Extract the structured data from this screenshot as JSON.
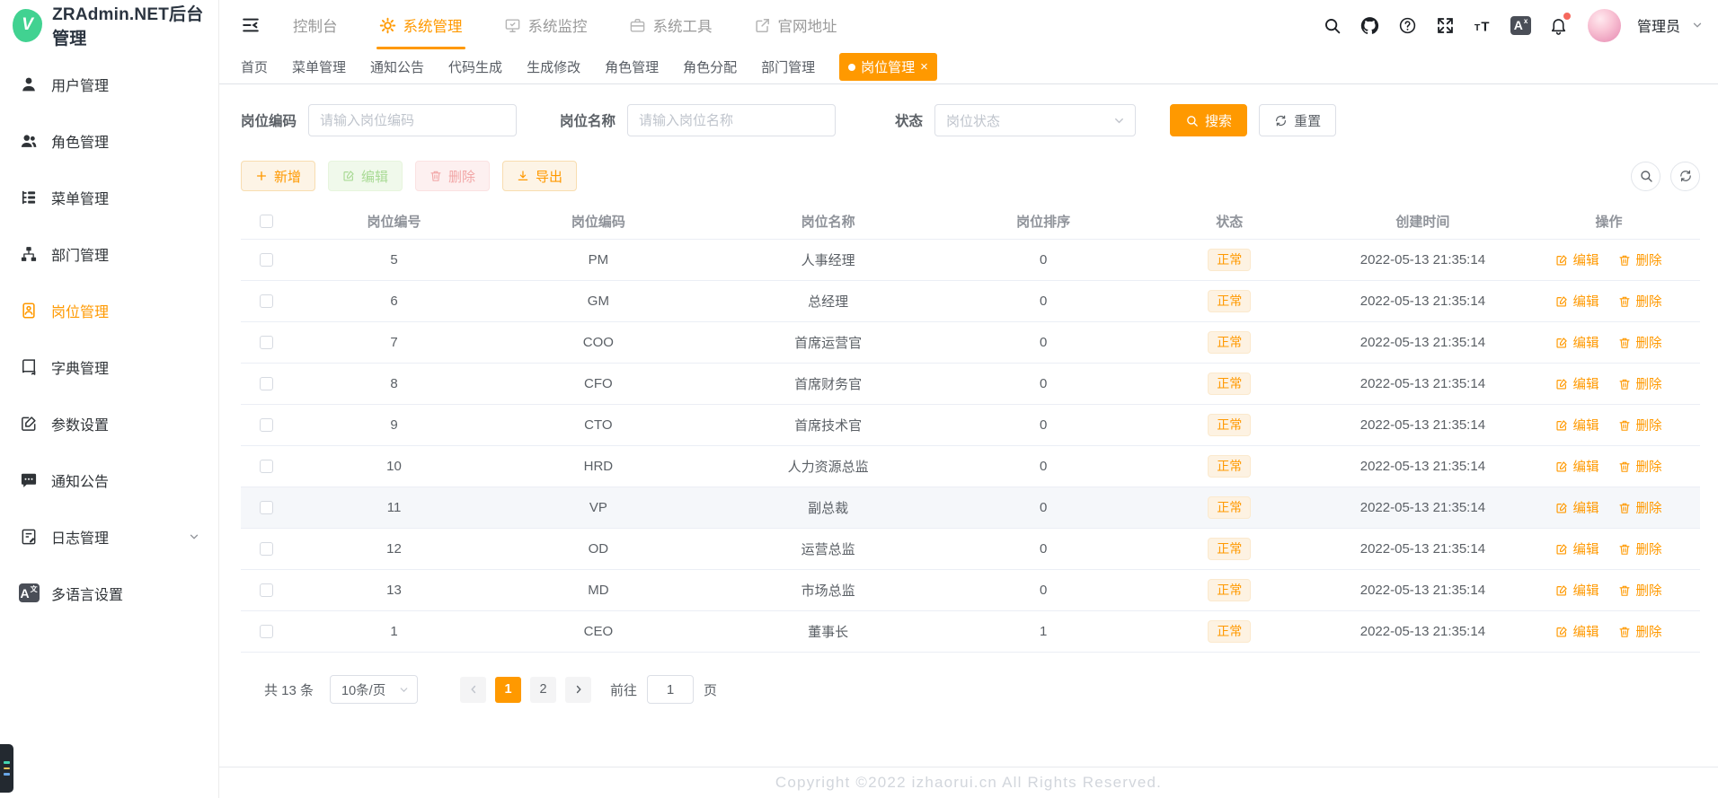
{
  "app": {
    "title": "ZRAdmin.NET后台管理",
    "logo_letter": "V"
  },
  "colors": {
    "primary": "#ff9900",
    "danger": "#f5685d",
    "success": "#67c23a"
  },
  "header": {
    "nav": [
      {
        "key": "console",
        "label": "控制台",
        "icon": "",
        "active": false
      },
      {
        "key": "system-manage",
        "label": "系统管理",
        "icon": "gear",
        "active": true
      },
      {
        "key": "system-monitor",
        "label": "系统监控",
        "icon": "monitor",
        "active": false
      },
      {
        "key": "system-tools",
        "label": "系统工具",
        "icon": "briefcase",
        "active": false
      },
      {
        "key": "website",
        "label": "官网地址",
        "icon": "external",
        "active": false
      }
    ],
    "tools": [
      {
        "key": "search",
        "icon": "search",
        "badge": false
      },
      {
        "key": "github",
        "icon": "github",
        "badge": false
      },
      {
        "key": "help",
        "icon": "question",
        "badge": false
      },
      {
        "key": "fullscreen",
        "icon": "fullscreen",
        "badge": false
      },
      {
        "key": "font-size",
        "icon": "fontsize",
        "badge": false
      },
      {
        "key": "translate",
        "icon": "translate",
        "badge": false
      },
      {
        "key": "notifications",
        "icon": "bell",
        "badge": true
      }
    ],
    "user": {
      "name": "管理员"
    }
  },
  "sidebar": {
    "items": [
      {
        "key": "user",
        "label": "用户管理",
        "icon": "user",
        "active": false,
        "arrow": false
      },
      {
        "key": "role",
        "label": "角色管理",
        "icon": "users",
        "active": false,
        "arrow": false
      },
      {
        "key": "menu",
        "label": "菜单管理",
        "icon": "menu-tree",
        "active": false,
        "arrow": false
      },
      {
        "key": "dept",
        "label": "部门管理",
        "icon": "org",
        "active": false,
        "arrow": false
      },
      {
        "key": "post",
        "label": "岗位管理",
        "icon": "badge-card",
        "active": true,
        "arrow": false
      },
      {
        "key": "dict",
        "label": "字典管理",
        "icon": "book",
        "active": false,
        "arrow": false
      },
      {
        "key": "param",
        "label": "参数设置",
        "icon": "edit-square",
        "active": false,
        "arrow": false
      },
      {
        "key": "notice",
        "label": "通知公告",
        "icon": "chat",
        "active": false,
        "arrow": false
      },
      {
        "key": "log",
        "label": "日志管理",
        "icon": "log",
        "active": false,
        "arrow": true
      },
      {
        "key": "lang",
        "label": "多语言设置",
        "icon": "language",
        "active": false,
        "arrow": false
      }
    ]
  },
  "tabs": {
    "items": [
      {
        "key": "home",
        "label": "首页",
        "active": false,
        "closable": false
      },
      {
        "key": "menu",
        "label": "菜单管理",
        "active": false,
        "closable": false
      },
      {
        "key": "notice",
        "label": "通知公告",
        "active": false,
        "closable": false
      },
      {
        "key": "gen-code",
        "label": "代码生成",
        "active": false,
        "closable": false
      },
      {
        "key": "gen-edit",
        "label": "生成修改",
        "active": false,
        "closable": false
      },
      {
        "key": "role",
        "label": "角色管理",
        "active": false,
        "closable": false
      },
      {
        "key": "role-assign",
        "label": "角色分配",
        "active": false,
        "closable": false
      },
      {
        "key": "dept",
        "label": "部门管理",
        "active": false,
        "closable": false
      },
      {
        "key": "post",
        "label": "岗位管理",
        "active": true,
        "closable": true
      }
    ]
  },
  "search_form": {
    "fields": [
      {
        "label": "岗位编码",
        "placeholder": "请输入岗位编码",
        "type": "input"
      },
      {
        "label": "岗位名称",
        "placeholder": "请输入岗位名称",
        "type": "input"
      },
      {
        "label": "状态",
        "placeholder": "岗位状态",
        "type": "select"
      }
    ],
    "search_label": "搜索",
    "reset_label": "重置"
  },
  "toolbar": {
    "buttons": [
      {
        "key": "add",
        "label": "新增",
        "icon": "plus",
        "variant": "warning",
        "disabled": false
      },
      {
        "key": "edit",
        "label": "编辑",
        "icon": "edit",
        "variant": "success",
        "disabled": true
      },
      {
        "key": "delete",
        "label": "删除",
        "icon": "trash",
        "variant": "danger",
        "disabled": true
      },
      {
        "key": "export",
        "label": "导出",
        "icon": "download",
        "variant": "warning",
        "disabled": false
      }
    ]
  },
  "table": {
    "columns": [
      "",
      "岗位编号",
      "岗位编码",
      "岗位名称",
      "岗位排序",
      "状态",
      "创建时间",
      "操作"
    ],
    "edit_label": "编辑",
    "delete_label": "删除",
    "rows": [
      {
        "id": "5",
        "code": "PM",
        "name": "人事经理",
        "sort": "0",
        "status": "正常",
        "created": "2022-05-13 21:35:14",
        "highlight": false
      },
      {
        "id": "6",
        "code": "GM",
        "name": "总经理",
        "sort": "0",
        "status": "正常",
        "created": "2022-05-13 21:35:14",
        "highlight": false
      },
      {
        "id": "7",
        "code": "COO",
        "name": "首席运营官",
        "sort": "0",
        "status": "正常",
        "created": "2022-05-13 21:35:14",
        "highlight": false
      },
      {
        "id": "8",
        "code": "CFO",
        "name": "首席财务官",
        "sort": "0",
        "status": "正常",
        "created": "2022-05-13 21:35:14",
        "highlight": false
      },
      {
        "id": "9",
        "code": "CTO",
        "name": "首席技术官",
        "sort": "0",
        "status": "正常",
        "created": "2022-05-13 21:35:14",
        "highlight": false
      },
      {
        "id": "10",
        "code": "HRD",
        "name": "人力资源总监",
        "sort": "0",
        "status": "正常",
        "created": "2022-05-13 21:35:14",
        "highlight": false
      },
      {
        "id": "11",
        "code": "VP",
        "name": "副总裁",
        "sort": "0",
        "status": "正常",
        "created": "2022-05-13 21:35:14",
        "highlight": true
      },
      {
        "id": "12",
        "code": "OD",
        "name": "运营总监",
        "sort": "0",
        "status": "正常",
        "created": "2022-05-13 21:35:14",
        "highlight": false
      },
      {
        "id": "13",
        "code": "MD",
        "name": "市场总监",
        "sort": "0",
        "status": "正常",
        "created": "2022-05-13 21:35:14",
        "highlight": false
      },
      {
        "id": "1",
        "code": "CEO",
        "name": "董事长",
        "sort": "1",
        "status": "正常",
        "created": "2022-05-13 21:35:14",
        "highlight": false
      }
    ]
  },
  "pagination": {
    "total_label": "共 13 条",
    "page_size": "10条/页",
    "pages": [
      {
        "label": "1",
        "active": true
      },
      {
        "label": "2",
        "active": false
      }
    ],
    "goto_label": "前往",
    "goto_value": "1",
    "unit_label": "页"
  },
  "footer": {
    "copyright": "Copyright ©2022 izhaorui.cn All Rights Reserved."
  }
}
